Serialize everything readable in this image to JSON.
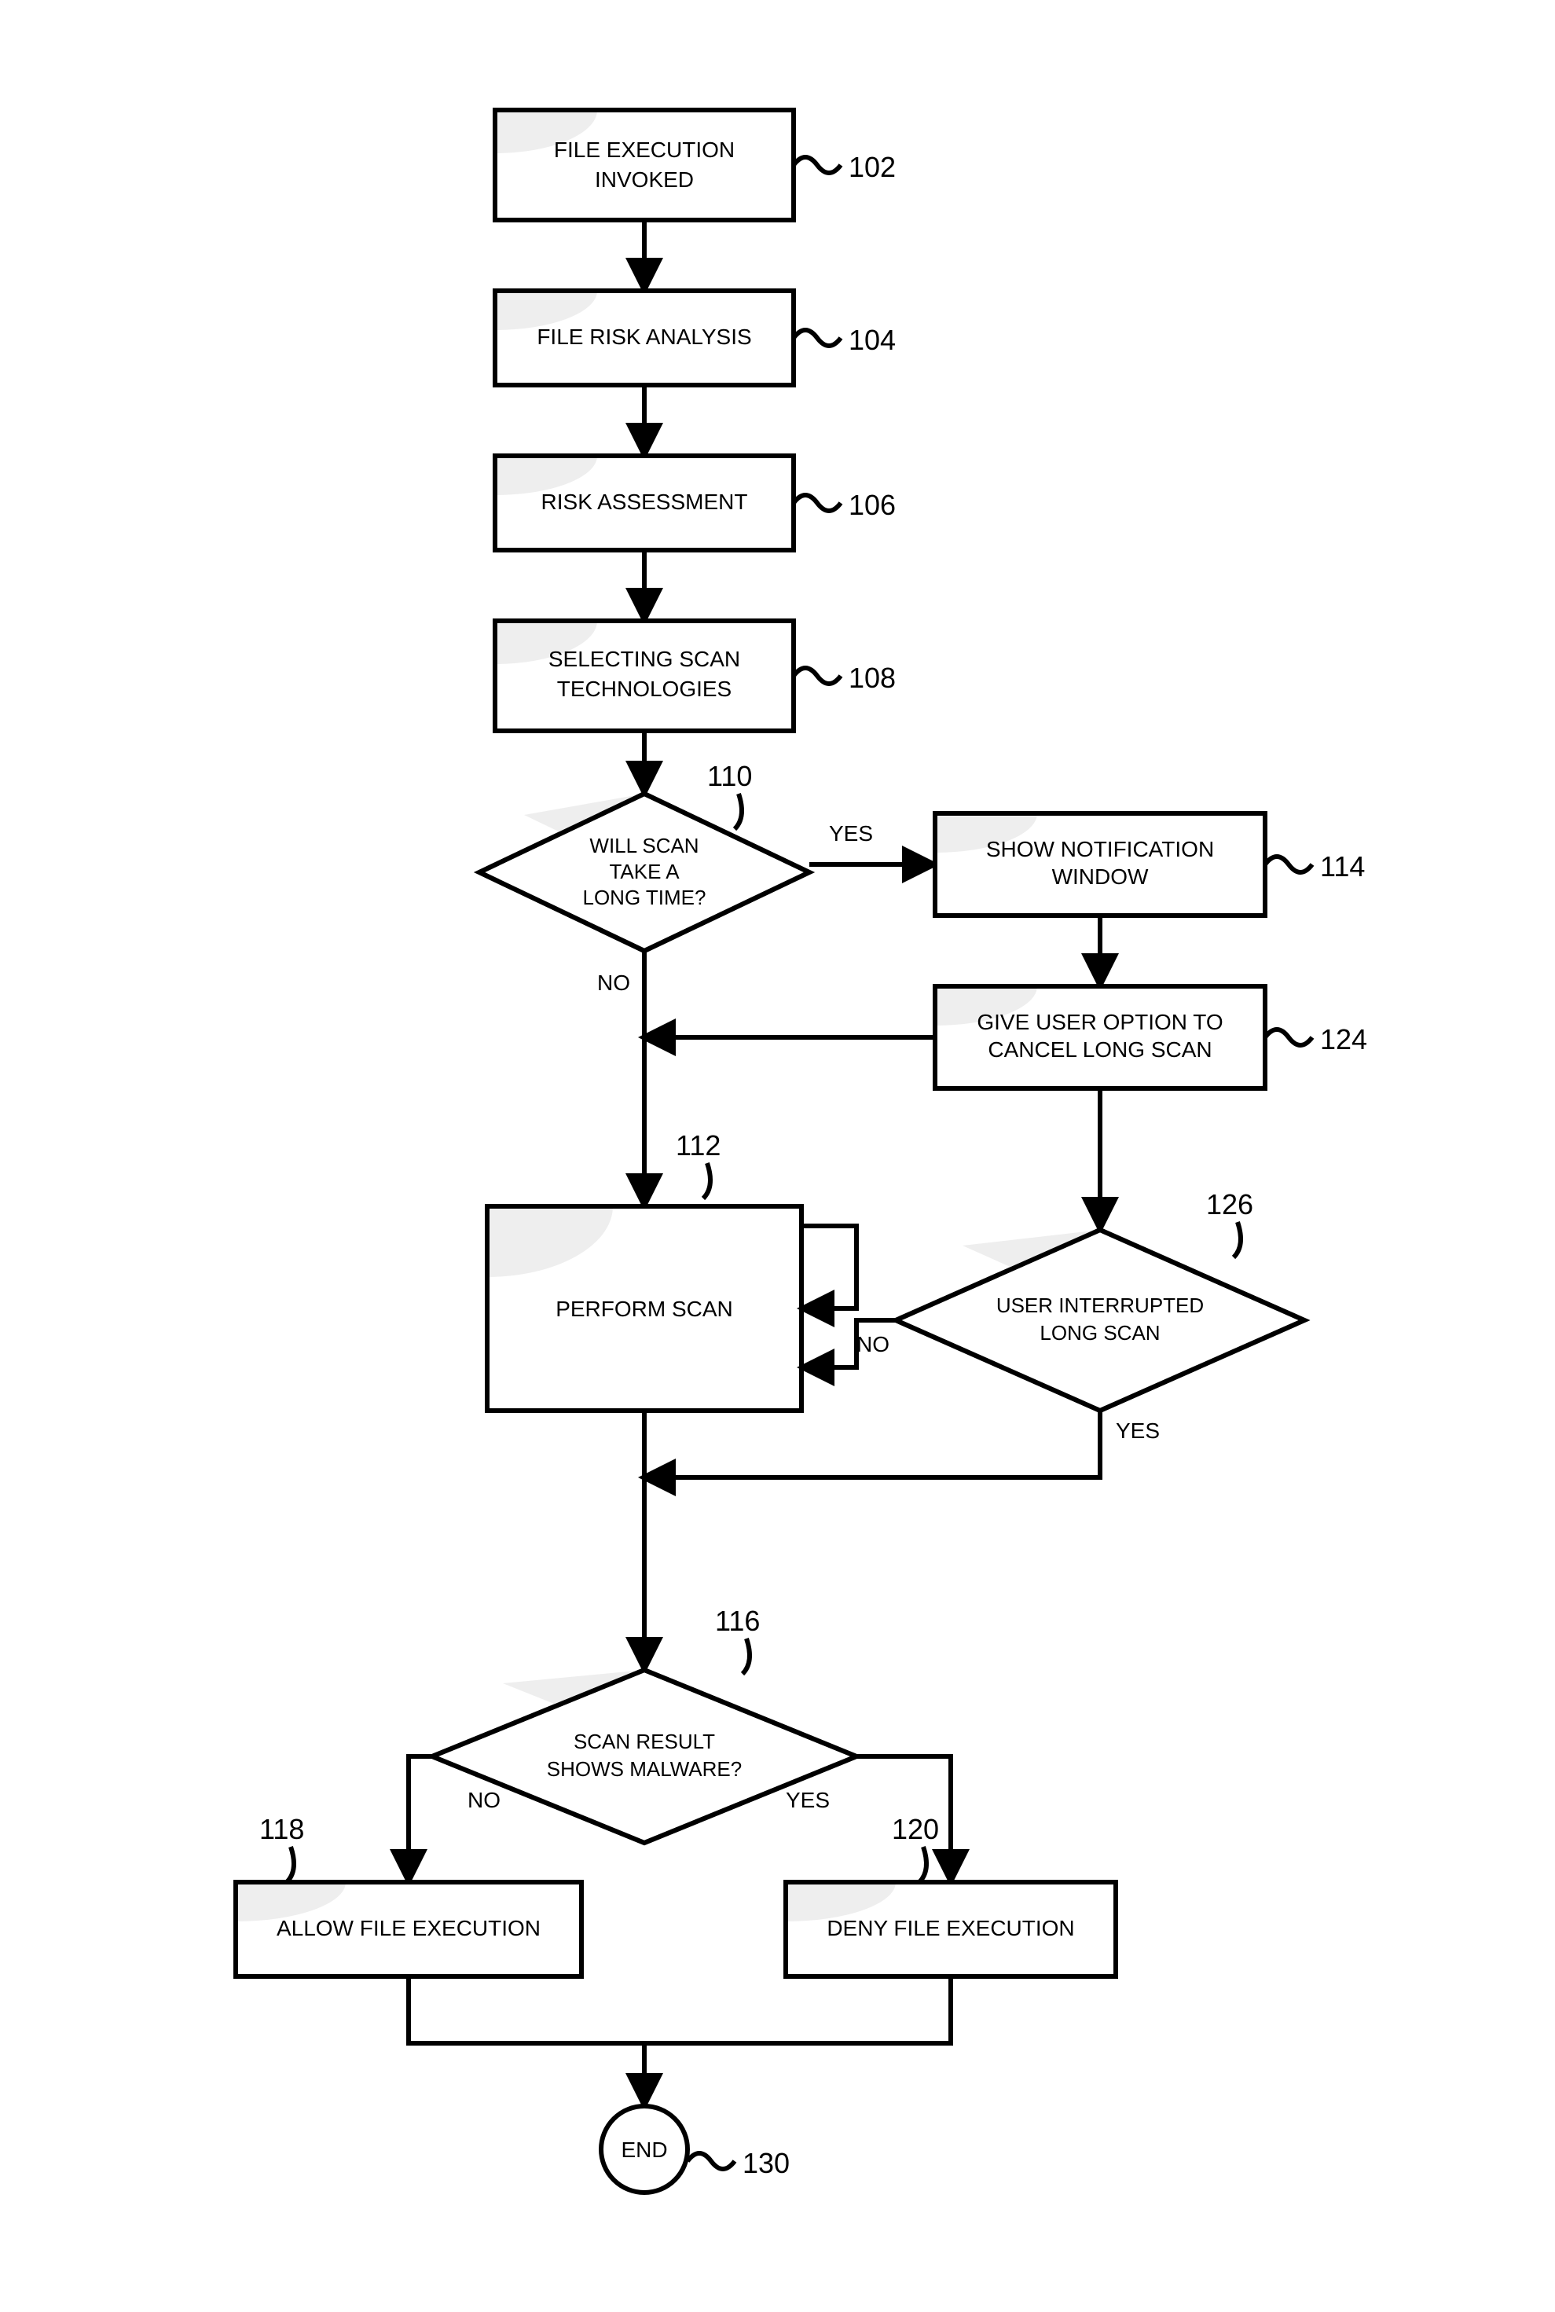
{
  "diagram": {
    "type": "flowchart",
    "nodes": {
      "n102": {
        "text_l1": "FILE EXECUTION",
        "text_l2": "INVOKED",
        "ref": "102",
        "shape": "process"
      },
      "n104": {
        "text_l1": "FILE RISK ANALYSIS",
        "ref": "104",
        "shape": "process"
      },
      "n106": {
        "text_l1": "RISK ASSESSMENT",
        "ref": "106",
        "shape": "process"
      },
      "n108": {
        "text_l1": "SELECTING SCAN",
        "text_l2": "TECHNOLOGIES",
        "ref": "108",
        "shape": "process"
      },
      "n110": {
        "text_l1": "WILL SCAN",
        "text_l2": "TAKE A",
        "text_l3": "LONG TIME?",
        "ref": "110",
        "shape": "decision"
      },
      "n114": {
        "text_l1": "SHOW NOTIFICATION",
        "text_l2": "WINDOW",
        "ref": "114",
        "shape": "process"
      },
      "n124": {
        "text_l1": "GIVE USER OPTION TO",
        "text_l2": "CANCEL LONG SCAN",
        "ref": "124",
        "shape": "process"
      },
      "n112": {
        "text_l1": "PERFORM SCAN",
        "ref": "112",
        "shape": "process"
      },
      "n126": {
        "text_l1": "USER INTERRUPTED",
        "text_l2": "LONG SCAN",
        "ref": "126",
        "shape": "decision"
      },
      "n116": {
        "text_l1": "SCAN RESULT",
        "text_l2": "SHOWS MALWARE?",
        "ref": "116",
        "shape": "decision"
      },
      "n118": {
        "text_l1": "ALLOW FILE EXECUTION",
        "ref": "118",
        "shape": "process"
      },
      "n120": {
        "text_l1": "DENY FILE EXECUTION",
        "ref": "120",
        "shape": "process"
      },
      "n130": {
        "text_l1": "END",
        "ref": "130",
        "shape": "terminator"
      }
    },
    "edge_labels": {
      "yes110": "YES",
      "no110": "NO",
      "no126": "NO",
      "yes126": "YES",
      "no116": "NO",
      "yes116": "YES"
    }
  }
}
